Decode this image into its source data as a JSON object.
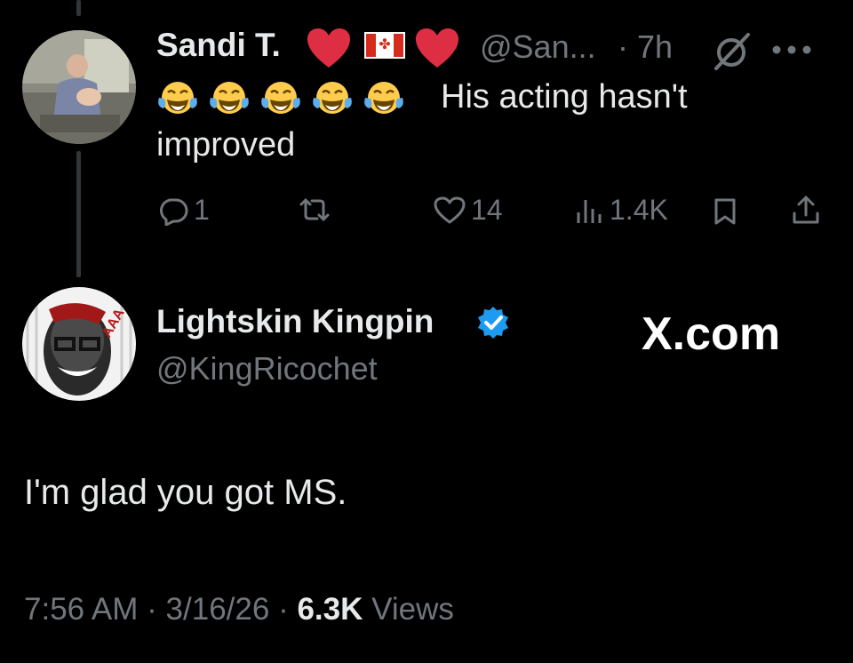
{
  "reply": {
    "display_name": "Sandi T.",
    "handle": "@San...",
    "time": "· 7h",
    "text_line1": "His acting hasn't",
    "text_line2": "improved",
    "stats": {
      "replies": "1",
      "likes": "14",
      "views": "1.4K"
    }
  },
  "main_tweet": {
    "display_name": "Lightskin Kingpin",
    "handle": "@KingRicochet",
    "watermark": "X.com",
    "text": "I'm glad you got MS.",
    "time": "7:56 AM",
    "date": "3/16/26",
    "views_count": "6.3K",
    "views_label": "Views"
  },
  "colors": {
    "verified": "#1d9bf0",
    "heart": "#dd2e44",
    "muted": "#71767b"
  }
}
